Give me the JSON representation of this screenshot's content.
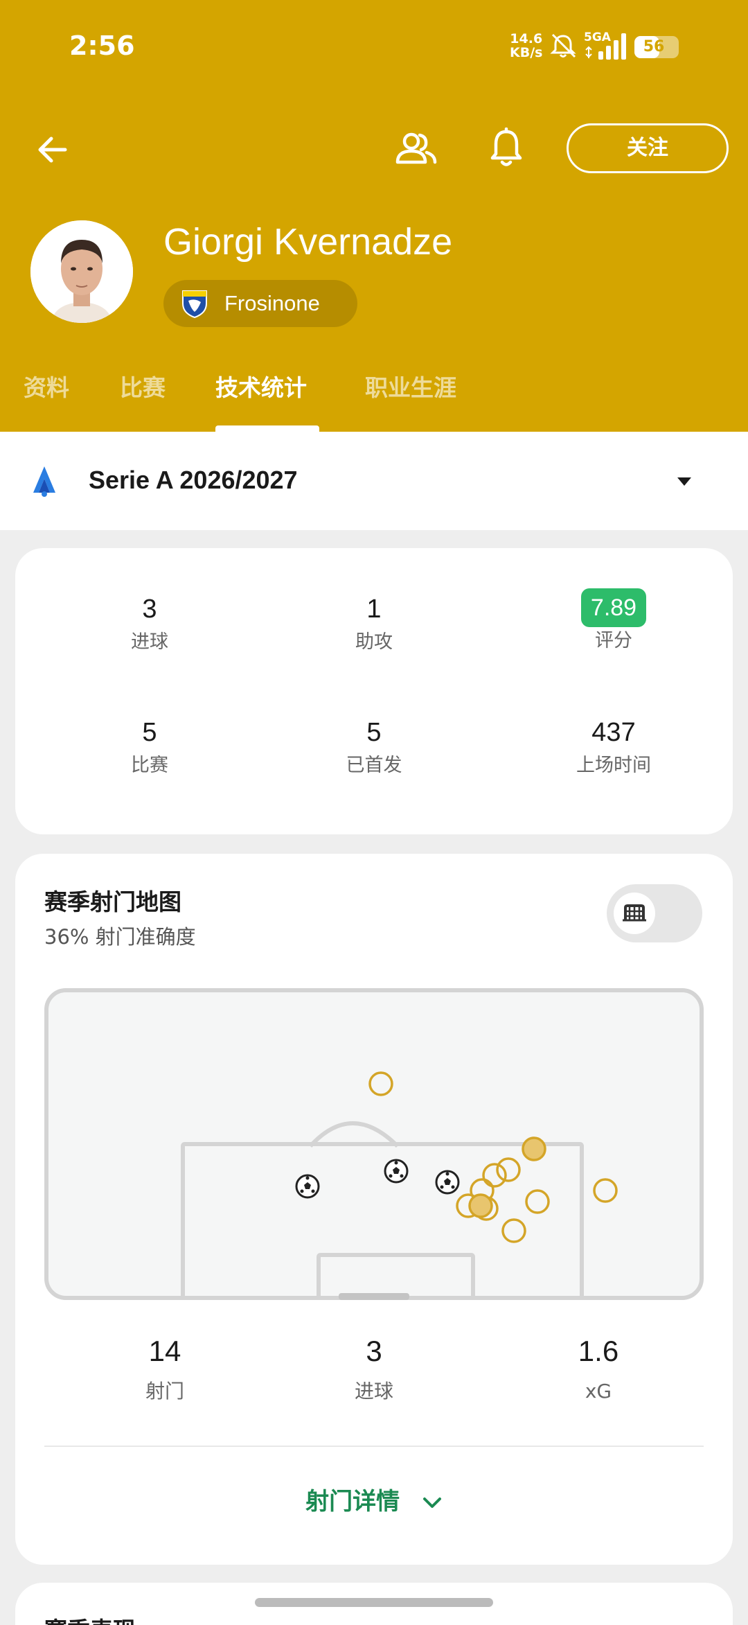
{
  "status_bar": {
    "time": "2:56",
    "net_speed_value": "14.6",
    "net_speed_unit": "KB/s",
    "network": "5GA",
    "battery": "56",
    "battery_level": 0.56
  },
  "header": {
    "follow_label": "关注",
    "player_name": "Giorgi Kvernadze",
    "team_name": "Frosinone",
    "accent_color": "#d4a500"
  },
  "tabs": [
    {
      "label": "资料"
    },
    {
      "label": "比赛"
    },
    {
      "label": "技术统计",
      "active": true
    },
    {
      "label": "职业生涯"
    }
  ],
  "league": {
    "name": "Serie A 2026/2027"
  },
  "stats": [
    {
      "value": "3",
      "label": "进球"
    },
    {
      "value": "1",
      "label": "助攻"
    },
    {
      "value": "7.89",
      "label": "评分",
      "badge_color": "#2dbc6a"
    },
    {
      "value": "5",
      "label": "比赛"
    },
    {
      "value": "5",
      "label": "已首发"
    },
    {
      "value": "437",
      "label": "上场时间"
    }
  ],
  "shot_map": {
    "title": "赛季射门地图",
    "accuracy": "36% 射门准确度",
    "summary": [
      {
        "value": "14",
        "label": "射门"
      },
      {
        "value": "3",
        "label": "进球"
      },
      {
        "value": "1.6",
        "label": "xG"
      }
    ],
    "details_label": "射门详情"
  },
  "next_section": {
    "title": "赛季表现"
  }
}
